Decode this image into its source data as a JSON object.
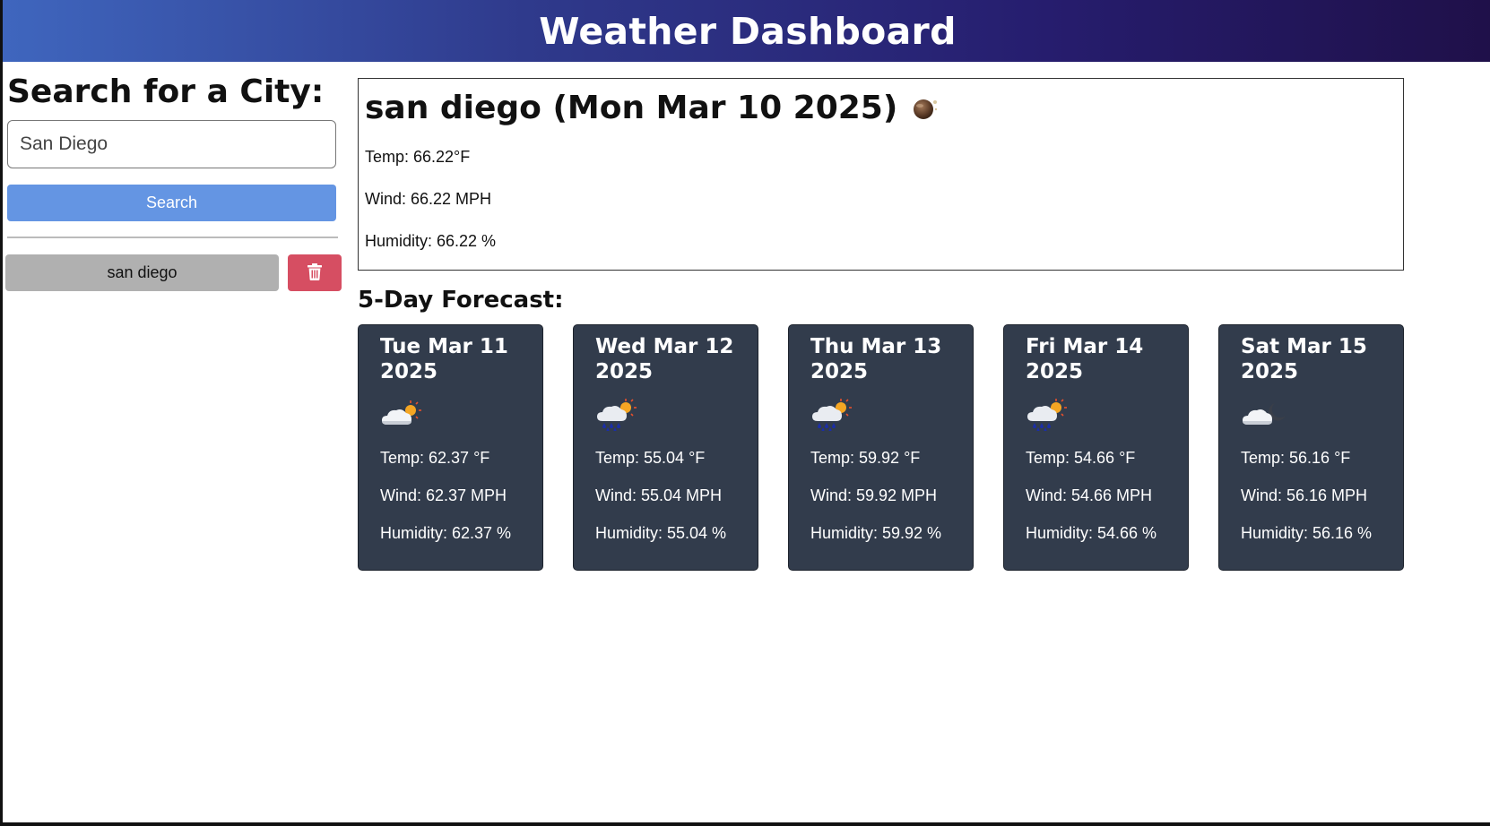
{
  "header": {
    "title": "Weather Dashboard"
  },
  "sidebar": {
    "heading": "Search for a City:",
    "search_value": "San Diego",
    "search_placeholder": "San Diego",
    "search_button": "Search",
    "history": [
      {
        "label": "san diego"
      }
    ],
    "delete_icon": "trash-icon"
  },
  "current": {
    "title": "san diego (Mon Mar 10 2025)",
    "icon": "moon-icon",
    "temp": "Temp: 66.22°F",
    "wind": "Wind: 66.22 MPH",
    "humidity": "Humidity: 66.22 %"
  },
  "forecast": {
    "title": "5-Day Forecast:",
    "days": [
      {
        "date": "Tue Mar 11 2025",
        "icon": "partly-cloudy-day-icon",
        "temp": "Temp: 62.37 °F",
        "wind": "Wind: 62.37 MPH",
        "humidity": "Humidity: 62.37 %"
      },
      {
        "date": "Wed Mar 12 2025",
        "icon": "rain-sun-icon",
        "temp": "Temp: 55.04 °F",
        "wind": "Wind: 55.04 MPH",
        "humidity": "Humidity: 55.04 %"
      },
      {
        "date": "Thu Mar 13 2025",
        "icon": "rain-sun-icon",
        "temp": "Temp: 59.92 °F",
        "wind": "Wind: 59.92 MPH",
        "humidity": "Humidity: 59.92 %"
      },
      {
        "date": "Fri Mar 14 2025",
        "icon": "rain-sun-icon",
        "temp": "Temp: 54.66 °F",
        "wind": "Wind: 54.66 MPH",
        "humidity": "Humidity: 54.66 %"
      },
      {
        "date": "Sat Mar 15 2025",
        "icon": "partly-cloudy-night-icon",
        "temp": "Temp: 56.16 °F",
        "wind": "Wind: 56.16 MPH",
        "humidity": "Humidity: 56.16 %"
      }
    ]
  }
}
